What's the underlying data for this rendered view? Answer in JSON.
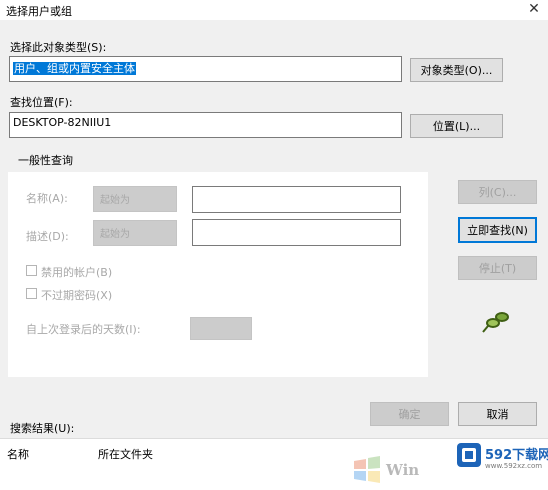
{
  "window": {
    "title": "选择用户或组"
  },
  "object_type": {
    "label": "选择此对象类型(S):",
    "value": "用户、组或内置安全主体",
    "button": "对象类型(O)..."
  },
  "location": {
    "label": "查找位置(F):",
    "value": "DESKTOP-82NIIU1",
    "button": "位置(L)..."
  },
  "query": {
    "group_label": "一般性查询",
    "name_label": "名称(A):",
    "name_mode": "起始为",
    "desc_label": "描述(D):",
    "desc_mode": "起始为",
    "disabled_accounts": "禁用的帐户(B)",
    "no_expire": "不过期密码(X)",
    "days_label": "自上次登录后的天数(I):",
    "columns_button": "列(C)...",
    "find_now_button": "立即查找(N)",
    "stop_button": "停止(T)"
  },
  "footer": {
    "ok_button": "确定",
    "cancel_button": "取消"
  },
  "results": {
    "label": "搜索结果(U):",
    "columns": [
      "名称",
      "所在文件夹"
    ]
  },
  "watermark": {
    "brand": "592下载网",
    "url": "www.592xz.com",
    "os_text": "Win"
  },
  "colors": {
    "accent": "#0078d7",
    "watermark_blue": "#1d64b8"
  }
}
